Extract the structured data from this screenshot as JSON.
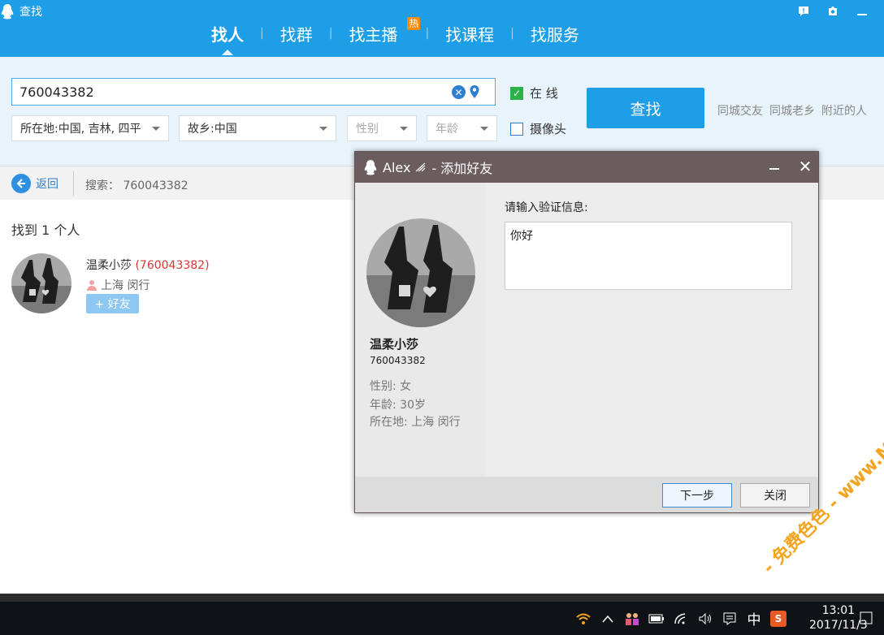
{
  "window": {
    "title": "查找"
  },
  "nav": {
    "tabs": [
      {
        "label": "找人",
        "active": true
      },
      {
        "label": "找群"
      },
      {
        "label": "找主播",
        "badge": "热"
      },
      {
        "label": "找课程"
      },
      {
        "label": "找服务"
      }
    ],
    "separator": "|"
  },
  "search": {
    "query": "760043382",
    "location_label": "所在地:中国, 吉林, 四平",
    "hometown_label": "故乡:中国",
    "gender_placeholder": "性别",
    "age_placeholder": "年龄",
    "online_label": "在  线",
    "online_checked": true,
    "camera_label": "摄像头",
    "camera_checked": false,
    "button_label": "查找",
    "quick_links": [
      "同城交友",
      "同城老乡",
      "附近的人"
    ]
  },
  "results_bar": {
    "back_label": "返回",
    "search_prefix": "搜索：",
    "search_value": "760043382"
  },
  "results": {
    "count_text": "找到 1 个人",
    "items": [
      {
        "name": "温柔小莎",
        "qq": "(760043382)",
        "location": "上海 闵行",
        "add_label": "+ 好友"
      }
    ]
  },
  "dialog": {
    "title_user": "Alex",
    "title_action": " - 添加好友",
    "profile": {
      "name": "温柔小莎",
      "qq": "760043382",
      "gender": "性别: 女",
      "age": "年龄: 30岁",
      "location": "所在地: 上海  闵行"
    },
    "verify_label": "请输入验证信息:",
    "verify_value": "你好",
    "next_label": "下一步",
    "close_label": "关闭"
  },
  "taskbar": {
    "ime": "中",
    "sogou": "S",
    "time": "13:01",
    "date": "2017/11/3"
  },
  "watermark": {
    "text": "- 免费色色 - www.MFsese.com"
  },
  "colors": {
    "header_blue": "#1e9ee7",
    "search_bg": "#e9f3fb",
    "dialog_title": "#6b5c5f",
    "qq_red": "#d33333",
    "watermark_orange": "#f5a41f"
  }
}
